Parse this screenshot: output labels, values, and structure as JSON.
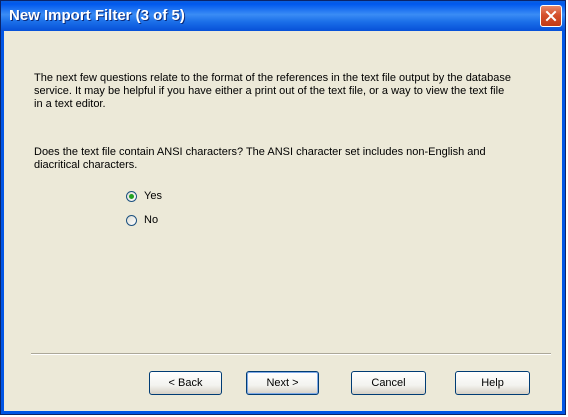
{
  "window": {
    "title": "New Import Filter (3 of 5)"
  },
  "content": {
    "intro_text": "The next few questions relate to the format of the references in the text file output by the database service.  It may be helpful if you have either a print out of the text file, or a way to view the text file in a text editor.",
    "question_text": "Does the text file contain ANSI characters?  The ANSI character set includes non-English and diacritical characters.",
    "options": [
      {
        "label": "Yes",
        "selected": true
      },
      {
        "label": "No",
        "selected": false
      }
    ]
  },
  "buttons": {
    "back_label": "< Back",
    "next_label": "Next >",
    "cancel_label": "Cancel",
    "help_label": "Help"
  },
  "colors": {
    "title_bar": "#0058ee",
    "close_button": "#d5502c",
    "dialog_background": "#ece9d8",
    "radio_selected": "#21a121"
  },
  "icons": {
    "close": "close-icon"
  }
}
